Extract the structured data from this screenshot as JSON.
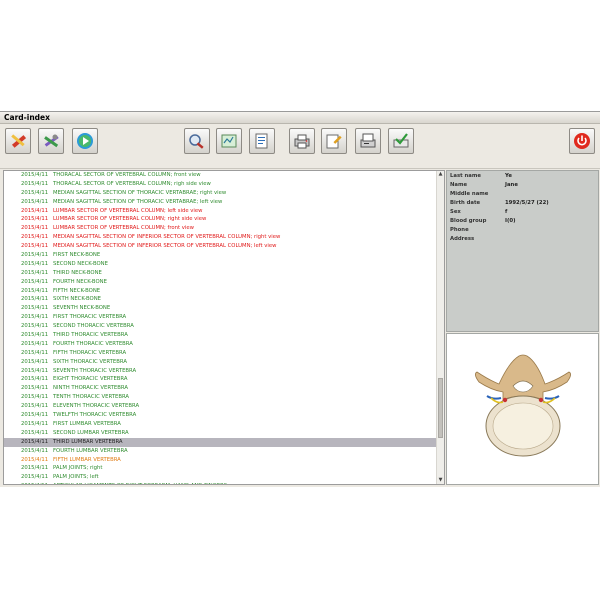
{
  "window": {
    "title": "Card-index"
  },
  "toolbar": {
    "left_buttons": [
      "pencil-ruler-icon",
      "tools-icon",
      "play-icon"
    ],
    "center_buttons": [
      "magnify-icon",
      "map-icon",
      "document-icon",
      "printer-icon",
      "edit-document-icon",
      "fax-icon",
      "checkmark-folder-icon"
    ],
    "right_button": "power-icon"
  },
  "records": [
    {
      "date": "2015/4/11",
      "text": "THORACAL SECTOR OF VERTEBRAL COLUMN; front view",
      "color": "green"
    },
    {
      "date": "2015/4/11",
      "text": "THORACAL SECTOR OF VERTEBRAL COLUMN; righ side view",
      "color": "green"
    },
    {
      "date": "2015/4/11",
      "text": "MEDIAN SAGITTAL SECTION OF THORACIC VERTABRAE; right view",
      "color": "green"
    },
    {
      "date": "2015/4/11",
      "text": "MEDIAN SAGITTAL SECTION OF THORACIC VERTABRAE; left view",
      "color": "green"
    },
    {
      "date": "2015/4/11",
      "text": "LUMBAR SECTOR OF VERTEBRAL COLUMN; left side view",
      "color": "red"
    },
    {
      "date": "2015/4/11",
      "text": "LUMBAR SECTOR OF VERTEBRAL COLUMN; right side view",
      "color": "red"
    },
    {
      "date": "2015/4/11",
      "text": "LUMBAR SECTOR OF VERTEBRAL COLUMN; front view",
      "color": "red"
    },
    {
      "date": "2015/4/11",
      "text": "MEDIAN SAGITTAL SECTION OF INFERIOR SECTOR OF VERTEBRAL COLUMN; right view",
      "color": "red"
    },
    {
      "date": "2015/4/11",
      "text": "MEDIAN SAGITTAL SECTION OF INFERIOR SECTOR OF VERTEBRAL COLUMN; left view",
      "color": "red"
    },
    {
      "date": "2015/4/11",
      "text": "FIRST NECK-BONE",
      "color": "green"
    },
    {
      "date": "2015/4/11",
      "text": "SECOND NECK-BONE",
      "color": "green"
    },
    {
      "date": "2015/4/11",
      "text": "THIRD NECK-BONE",
      "color": "green"
    },
    {
      "date": "2015/4/11",
      "text": "FOURTH NECK-BONE",
      "color": "green"
    },
    {
      "date": "2015/4/11",
      "text": "FIFTH NECK-BONE",
      "color": "green"
    },
    {
      "date": "2015/4/11",
      "text": "SIXTH NECK-BONE",
      "color": "green"
    },
    {
      "date": "2015/4/11",
      "text": "SEVENTH NECK-BONE",
      "color": "green"
    },
    {
      "date": "2015/4/11",
      "text": "FIRST THORACIC VERTEBRA",
      "color": "green"
    },
    {
      "date": "2015/4/11",
      "text": "SECOND THORACIC VERTEBRA",
      "color": "green"
    },
    {
      "date": "2015/4/11",
      "text": "THIRD THORACIC VERTEBRA",
      "color": "green"
    },
    {
      "date": "2015/4/11",
      "text": "FOURTH THORACIC VERTEBRA",
      "color": "green"
    },
    {
      "date": "2015/4/11",
      "text": "FIFTH THORACIC VERTEBRA",
      "color": "green"
    },
    {
      "date": "2015/4/11",
      "text": "SIXTH THORACIC VERTEBRA",
      "color": "green"
    },
    {
      "date": "2015/4/11",
      "text": "SEVENTH THORACIC VERTEBRA",
      "color": "green"
    },
    {
      "date": "2015/4/11",
      "text": "EIGHT THORACIC VERTEBRA",
      "color": "green"
    },
    {
      "date": "2015/4/11",
      "text": "NINTH THORACIC VERTEBRA",
      "color": "green"
    },
    {
      "date": "2015/4/11",
      "text": "TENTH THORACIC VERTEBRA",
      "color": "green"
    },
    {
      "date": "2015/4/11",
      "text": "ELEVENTH THORACIC VERTEBRA",
      "color": "green"
    },
    {
      "date": "2015/4/11",
      "text": "TWELFTH THORACIC VERTEBRA",
      "color": "green"
    },
    {
      "date": "2015/4/11",
      "text": "FIRST LUMBAR VERTEBRA",
      "color": "green"
    },
    {
      "date": "2015/4/11",
      "text": "SECOND LUMBAR VERTEBRA",
      "color": "green"
    },
    {
      "date": "2015/4/11",
      "text": "THIRD LUMBAR VERTEBRA",
      "color": "selected"
    },
    {
      "date": "2015/4/11",
      "text": "FOURTH LUMBAR VERTEBRA",
      "color": "green"
    },
    {
      "date": "2015/4/11",
      "text": "FIFTH LUMBAR VERTEBRA",
      "color": "orange"
    },
    {
      "date": "2015/4/11",
      "text": "PALM JOINTS; right",
      "color": "green"
    },
    {
      "date": "2015/4/11",
      "text": "PALM JOINTS; left",
      "color": "green"
    },
    {
      "date": "2015/4/11",
      "text": "ARTICULAR LIGAMENTS OF RIGHT FOREARM, HAND AND FINGERS",
      "color": "green"
    }
  ],
  "patient": {
    "fields": [
      {
        "label": "Last name",
        "value": "Ye"
      },
      {
        "label": "Name",
        "value": "Jane"
      },
      {
        "label": "Middle name",
        "value": ""
      },
      {
        "label": "Birth date",
        "value": "1992/5/27 (22)"
      },
      {
        "label": "Sex",
        "value": "f"
      },
      {
        "label": "Blood group",
        "value": "I(0)"
      },
      {
        "label": "Phone",
        "value": ""
      },
      {
        "label": "Address",
        "value": ""
      }
    ]
  },
  "preview": {
    "image": "vertebra-illustration"
  },
  "colors": {
    "green": "#2e8b2e",
    "red": "#e01818",
    "orange": "#e07a10",
    "selected_bg": "#b7b5bd",
    "panel_bg": "#c9ccc9"
  }
}
